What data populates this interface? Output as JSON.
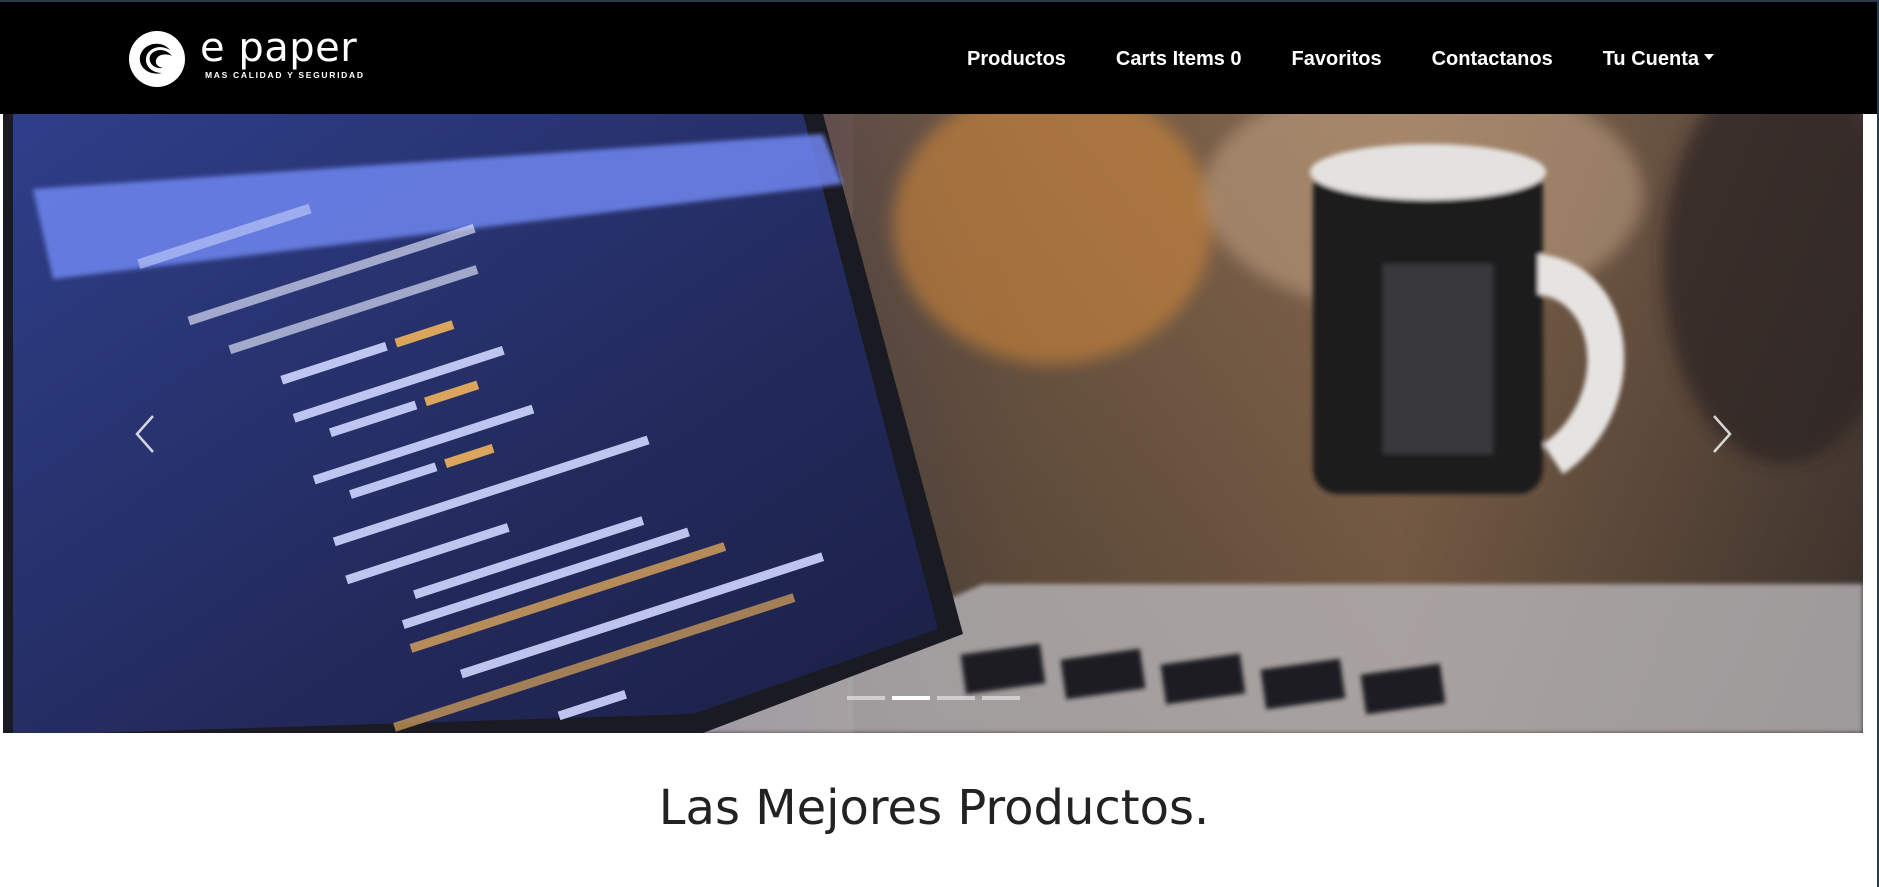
{
  "brand": {
    "name": "e paper",
    "tagline": "MAS CALIDAD Y SEGURIDAD",
    "logo_icon": "moon-wave-logo"
  },
  "nav": {
    "items": [
      {
        "label": "Productos"
      },
      {
        "label": "Carts Items 0"
      },
      {
        "label": "Favoritos"
      },
      {
        "label": "Contactanos"
      },
      {
        "label": "Tu Cuenta",
        "dropdown": true
      }
    ]
  },
  "carousel": {
    "prev_icon": "chevron-left-icon",
    "next_icon": "chevron-right-icon",
    "slide_count": 4,
    "active_index": 1
  },
  "main": {
    "heading": "Las Mejores Productos."
  },
  "colors": {
    "navbar_bg": "#000000",
    "heading_text": "#222222"
  }
}
